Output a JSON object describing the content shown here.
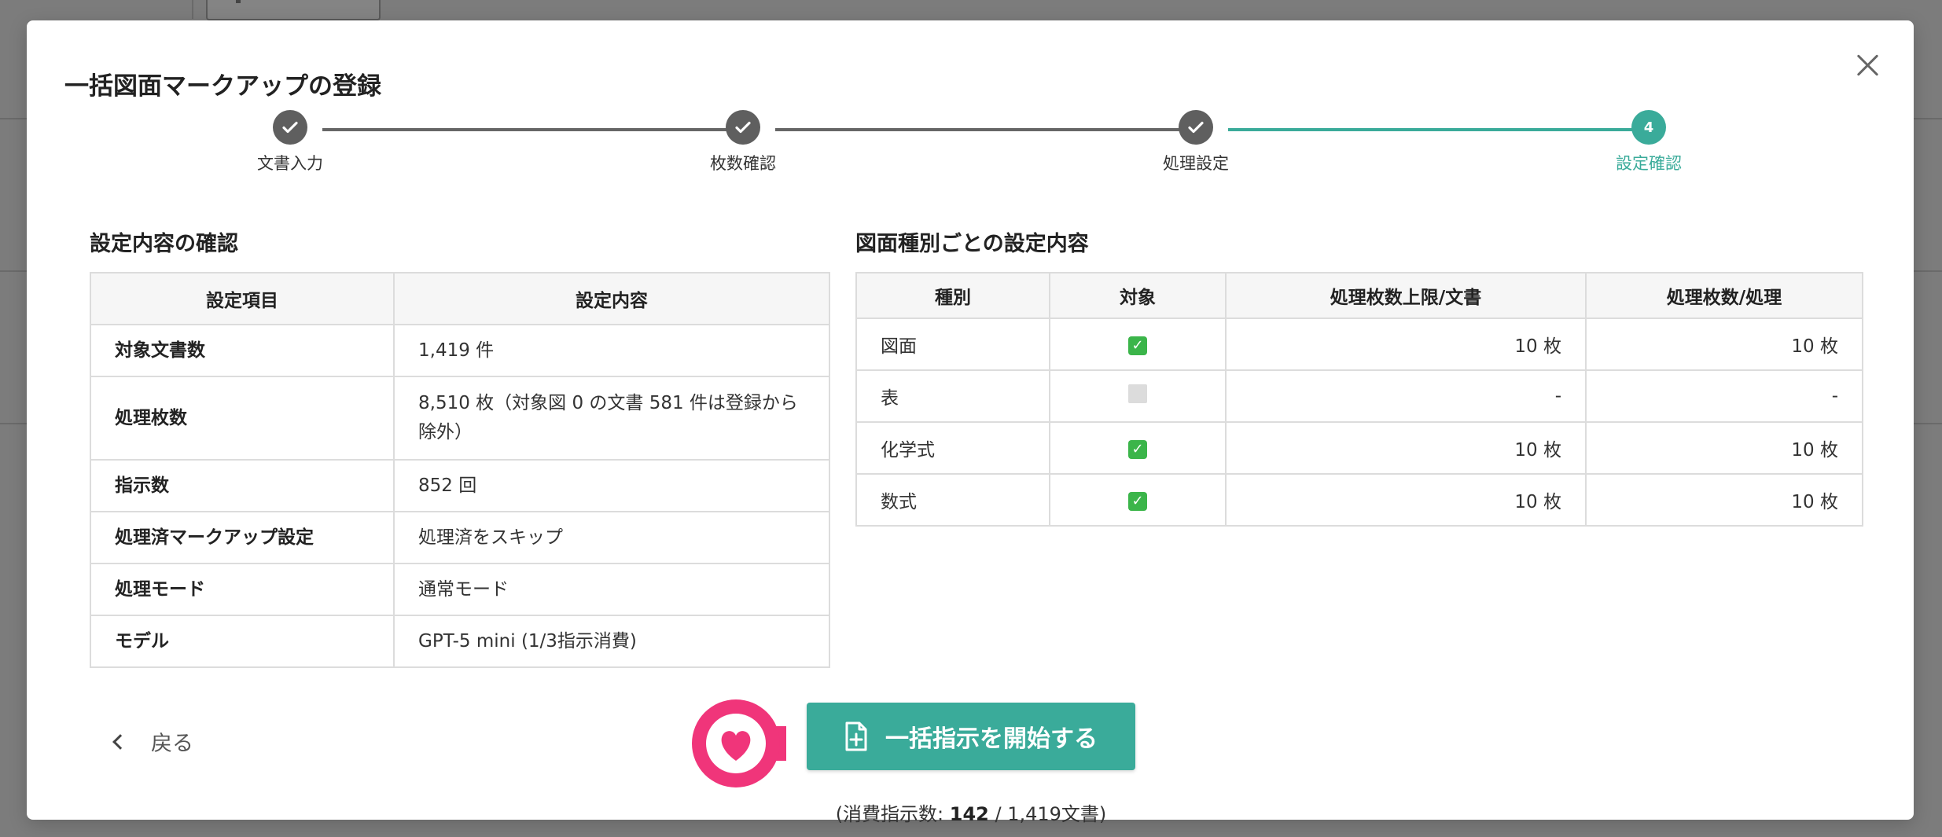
{
  "modal": {
    "title": "一括図面マークアップの登録",
    "steps": [
      {
        "label": "文書入力",
        "state": "done"
      },
      {
        "label": "枚数確認",
        "state": "done"
      },
      {
        "label": "処理設定",
        "state": "done"
      },
      {
        "label": "設定確認",
        "state": "active",
        "number": "4"
      }
    ],
    "settings": {
      "title": "設定内容の確認",
      "headers": [
        "設定項目",
        "設定内容"
      ],
      "rows": [
        {
          "key": "対象文書数",
          "value": "1,419 件"
        },
        {
          "key": "処理枚数",
          "value": "8,510 枚（対象図 0 の文書 581 件は登録から除外）"
        },
        {
          "key": "指示数",
          "value": "852 回"
        },
        {
          "key": "処理済マークアップ設定",
          "value": "処理済をスキップ"
        },
        {
          "key": "処理モード",
          "value": "通常モード"
        },
        {
          "key": "モデル",
          "value": "GPT-5 mini (1/3指示消費)"
        }
      ]
    },
    "types": {
      "title": "図面種別ごとの設定内容",
      "headers": [
        "種別",
        "対象",
        "処理枚数上限/文書",
        "処理枚数/処理"
      ],
      "rows": [
        {
          "kind": "図面",
          "target": true,
          "limit": "10 枚",
          "per": "10 枚"
        },
        {
          "kind": "表",
          "target": false,
          "limit": "-",
          "per": "-"
        },
        {
          "kind": "化学式",
          "target": true,
          "limit": "10 枚",
          "per": "10 枚"
        },
        {
          "kind": "数式",
          "target": true,
          "limit": "10 枚",
          "per": "10 枚"
        }
      ]
    },
    "back_label": "戻る",
    "start_label": "一括指示を開始する",
    "usage": {
      "prefix": "(消費指示数: ",
      "count": "142",
      "suffix": " / 1,419文書)"
    }
  },
  "colors": {
    "accent": "#3aab9a",
    "badge": "#f0357a",
    "done": "#5f5f5f"
  },
  "icons": [
    "check-icon",
    "close-icon",
    "chevron-left-icon",
    "file-plus-icon",
    "heart-icon"
  ]
}
